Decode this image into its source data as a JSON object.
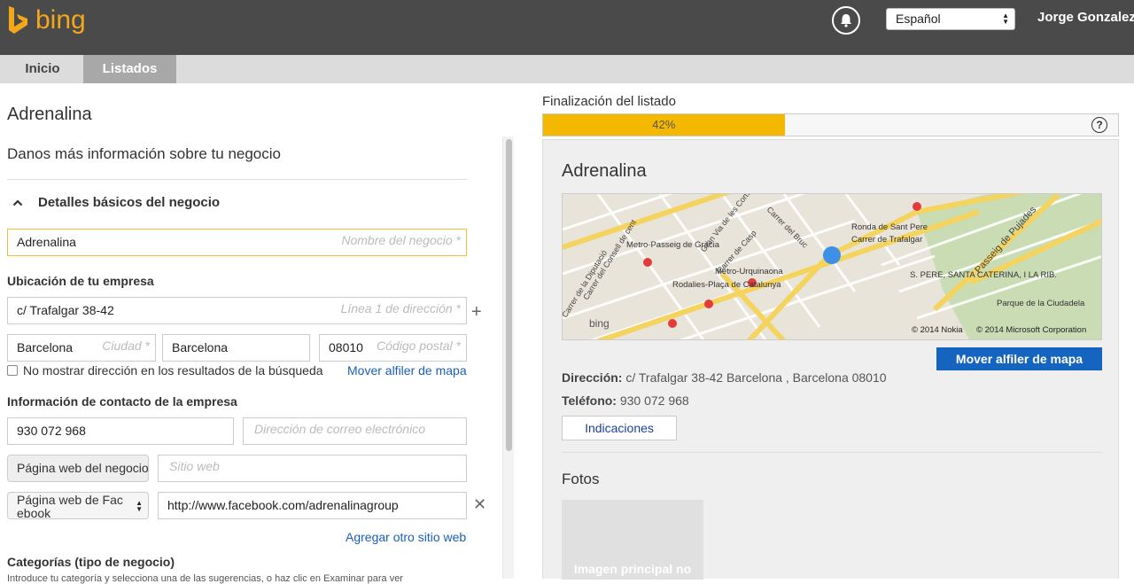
{
  "header": {
    "logo_text": "bing",
    "language": "Español",
    "user_name": "Jorge Gonzalez"
  },
  "tabs": [
    {
      "label": "Inicio",
      "active": false
    },
    {
      "label": "Listados",
      "active": true
    }
  ],
  "form": {
    "business_title": "Adrenalina",
    "subtitle": "Danos más información sobre tu negocio",
    "section_title": "Detalles básicos del negocio",
    "business_name": {
      "value": "Adrenalina",
      "placeholder": "Nombre del negocio *"
    },
    "location_label": "Ubicación de tu empresa",
    "address1": {
      "value": "c/ Trafalgar 38-42",
      "placeholder": "Línea 1 de dirección *"
    },
    "city": {
      "value": "Barcelona",
      "placeholder": "Ciudad *"
    },
    "province": {
      "value": "Barcelona"
    },
    "postal": {
      "value": "08010",
      "placeholder": "Código postal *"
    },
    "hide_address_label": "No mostrar dirección en los resultados de la búsqueda",
    "move_pin_link": "Mover alfiler de mapa",
    "contact_label": "Información de contacto de la empresa",
    "phone": {
      "value": "930 072 968"
    },
    "email": {
      "placeholder": "Dirección de correo electrónico"
    },
    "web_type_1": "Página web del negocio",
    "web_1": {
      "placeholder": "Sitio web"
    },
    "web_type_2": "Página web de Facebook",
    "web_2": {
      "value": "http://www.facebook.com/adrenalinagroup"
    },
    "add_website_link": "Agregar otro sitio web",
    "categories_label": "Categorías (tipo de negocio)",
    "categories_desc": "Introduce tu categoría y selecciona una de las sugerencias, o haz clic en Examinar para ver"
  },
  "progress": {
    "label": "Finalización del listado",
    "percent": 42,
    "percent_text": "42%"
  },
  "preview": {
    "title": "Adrenalina",
    "map_labels": {
      "metro1": "Metro-Passeig de Gràcia",
      "metro2": "Metro-Urquinaona",
      "metro3": "Rodalies-Plaça de Catalunya",
      "district": "S. PERE, SANTA CATERINA, I LA RIB.",
      "park": "Parque de la Ciudadela",
      "street1": "Carrer de Casp",
      "street2": "Passeig de Pujades",
      "street3": "Ronda de Sant Pere",
      "street4": "Carrer de Trafalgar",
      "street5": "Gran Via de les Corts",
      "street6": "Carrer de la Diputació",
      "street7": "Carrer del Consell de cent",
      "street8": "Carrer del Bruc",
      "copyright1": "© 2014 Nokia",
      "copyright2": "© 2014 Microsoft Corporation",
      "map_brand": "bing"
    },
    "move_pin_button": "Mover alfiler de mapa",
    "address_label": "Dirección:",
    "address_value": "c/ Trafalgar 38-42 Barcelona ,  Barcelona   08010",
    "phone_label": "Teléfono:",
    "phone_value": "930 072 968",
    "directions_button": "Indicaciones",
    "photos_title": "Fotos",
    "photo_placeholder": "Imagen principal no"
  },
  "colors": {
    "topbar": "#4a4a4a",
    "brand": "#f4a71b",
    "progress": "#f5b800",
    "primary_button": "#1565c0",
    "link": "#1b5fb8"
  }
}
